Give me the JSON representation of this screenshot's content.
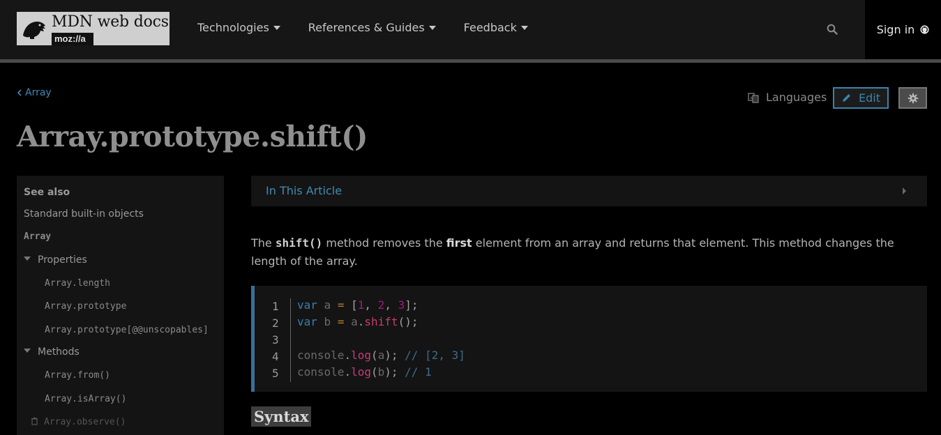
{
  "header": {
    "logo_title": "MDN web docs",
    "logo_sub": "moz://a",
    "nav": [
      {
        "label": "Technologies"
      },
      {
        "label": "References & Guides"
      },
      {
        "label": "Feedback"
      }
    ],
    "signin_label": "Sign in"
  },
  "breadcrumb": {
    "label": "Array"
  },
  "actions": {
    "languages_label": "Languages",
    "edit_label": "Edit"
  },
  "page_title": "Array.prototype.shift()",
  "sidebar": {
    "see_also": "See also",
    "standard_objects": "Standard built-in objects",
    "array": "Array",
    "properties_heading": "Properties",
    "properties": [
      "Array.length",
      "Array.prototype",
      "Array.prototype[@@unscopables]"
    ],
    "methods_heading": "Methods",
    "methods": [
      "Array.from()",
      "Array.isArray()",
      "Array.observe()"
    ]
  },
  "toc": {
    "title": "In This Article"
  },
  "intro": {
    "part1": "The ",
    "code": "shift()",
    "part2": " method removes the ",
    "strong": "first",
    "part3": " element from an array and returns that element. This method changes the length of the array."
  },
  "code": {
    "line_numbers": [
      "1",
      "2",
      "3",
      "4",
      "5"
    ]
  },
  "syntax_heading": "Syntax",
  "colors": {
    "link": "#3f8bb3",
    "edit_border": "#3b84ad",
    "header_bg": "#161616",
    "page_bg": "#000000"
  }
}
